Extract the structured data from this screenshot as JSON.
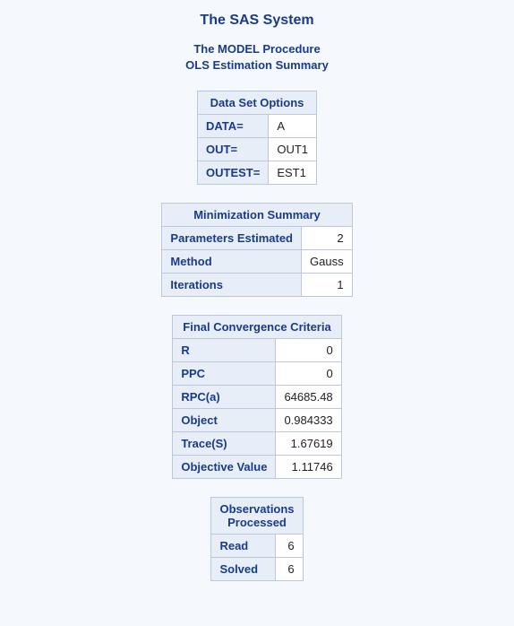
{
  "title": "The SAS System",
  "subtitle1": "The MODEL Procedure",
  "subtitle2": "OLS Estimation Summary",
  "tables": {
    "dataopts": {
      "caption": "Data Set Options",
      "rows": [
        {
          "label": "DATA=",
          "value": "A"
        },
        {
          "label": "OUT=",
          "value": "OUT1"
        },
        {
          "label": "OUTEST=",
          "value": "EST1"
        }
      ]
    },
    "minsum": {
      "caption": "Minimization Summary",
      "rows": [
        {
          "label": "Parameters Estimated",
          "value": "2"
        },
        {
          "label": "Method",
          "value": "Gauss"
        },
        {
          "label": "Iterations",
          "value": "1"
        }
      ]
    },
    "conv": {
      "caption": "Final Convergence Criteria",
      "rows": [
        {
          "label": "R",
          "value": "0"
        },
        {
          "label": "PPC",
          "value": "0"
        },
        {
          "label": "RPC(a)",
          "value": "64685.48"
        },
        {
          "label": "Object",
          "value": "0.984333"
        },
        {
          "label": "Trace(S)",
          "value": "1.67619"
        },
        {
          "label": "Objective Value",
          "value": "1.11746"
        }
      ]
    },
    "obs": {
      "caption1": "Observations",
      "caption2": "Processed",
      "rows": [
        {
          "label": "Read",
          "value": "6"
        },
        {
          "label": "Solved",
          "value": "6"
        }
      ]
    }
  }
}
